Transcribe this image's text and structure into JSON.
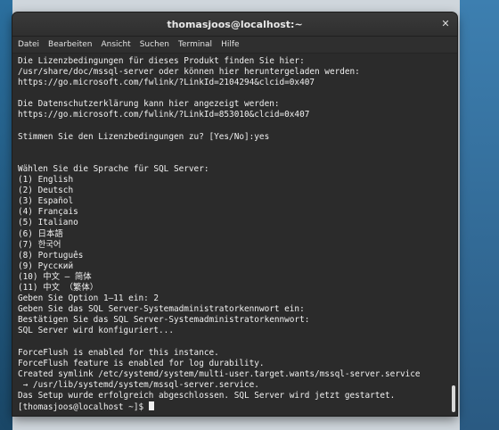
{
  "window": {
    "title": "thomasjoos@localhost:~",
    "close_glyph": "✕"
  },
  "menu": {
    "items": [
      "Datei",
      "Bearbeiten",
      "Ansicht",
      "Suchen",
      "Terminal",
      "Hilfe"
    ]
  },
  "terminal": {
    "lines": [
      "Die Lizenzbedingungen für dieses Produkt finden Sie hier:",
      "/usr/share/doc/mssql-server oder können hier heruntergeladen werden:",
      "https://go.microsoft.com/fwlink/?LinkId=2104294&clcid=0x407",
      "",
      "Die Datenschutzerklärung kann hier angezeigt werden:",
      "https://go.microsoft.com/fwlink/?LinkId=853010&clcid=0x407",
      "",
      "Stimmen Sie den Lizenzbedingungen zu? [Yes/No]:yes",
      "",
      "",
      "Wählen Sie die Sprache für SQL Server:",
      "(1) English",
      "(2) Deutsch",
      "(3) Español",
      "(4) Français",
      "(5) Italiano",
      "(6) 日本語",
      "(7) 한국어",
      "(8) Português",
      "(9) Русский",
      "(10) 中文 – 简体",
      "(11) 中文 （繁体）",
      "Geben Sie Option 1–11 ein: 2",
      "Geben Sie das SQL Server-Systemadministratorkennwort ein:",
      "Bestätigen Sie das SQL Server-Systemadministratorkennwort:",
      "SQL Server wird konfiguriert...",
      "",
      "ForceFlush is enabled for this instance.",
      "ForceFlush feature is enabled for log durability.",
      "Created symlink /etc/systemd/system/multi-user.target.wants/mssql-server.service",
      " → /usr/lib/systemd/system/mssql-server.service.",
      "Das Setup wurde erfolgreich abgeschlossen. SQL Server wird jetzt gestartet."
    ],
    "prompt": "[thomasjoos@localhost ~]$ "
  }
}
